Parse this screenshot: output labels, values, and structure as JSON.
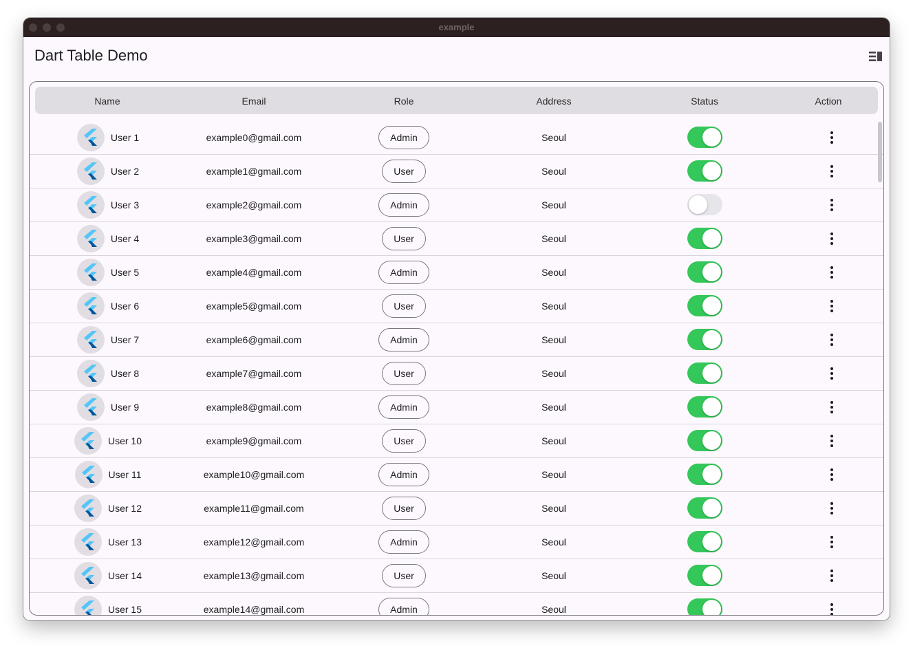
{
  "window": {
    "title": "example"
  },
  "appbar": {
    "title": "Dart Table Demo",
    "action_icon": "view-sidebar-icon"
  },
  "table": {
    "columns": [
      "Name",
      "Email",
      "Role",
      "Address",
      "Status",
      "Action"
    ],
    "rows": [
      {
        "name": "User 1",
        "email": "example0@gmail.com",
        "role": "Admin",
        "address": "Seoul",
        "status": true
      },
      {
        "name": "User 2",
        "email": "example1@gmail.com",
        "role": "User",
        "address": "Seoul",
        "status": true
      },
      {
        "name": "User 3",
        "email": "example2@gmail.com",
        "role": "Admin",
        "address": "Seoul",
        "status": false
      },
      {
        "name": "User 4",
        "email": "example3@gmail.com",
        "role": "User",
        "address": "Seoul",
        "status": true
      },
      {
        "name": "User 5",
        "email": "example4@gmail.com",
        "role": "Admin",
        "address": "Seoul",
        "status": true
      },
      {
        "name": "User 6",
        "email": "example5@gmail.com",
        "role": "User",
        "address": "Seoul",
        "status": true
      },
      {
        "name": "User 7",
        "email": "example6@gmail.com",
        "role": "Admin",
        "address": "Seoul",
        "status": true
      },
      {
        "name": "User 8",
        "email": "example7@gmail.com",
        "role": "User",
        "address": "Seoul",
        "status": true
      },
      {
        "name": "User 9",
        "email": "example8@gmail.com",
        "role": "Admin",
        "address": "Seoul",
        "status": true
      },
      {
        "name": "User 10",
        "email": "example9@gmail.com",
        "role": "User",
        "address": "Seoul",
        "status": true
      },
      {
        "name": "User 11",
        "email": "example10@gmail.com",
        "role": "Admin",
        "address": "Seoul",
        "status": true
      },
      {
        "name": "User 12",
        "email": "example11@gmail.com",
        "role": "User",
        "address": "Seoul",
        "status": true
      },
      {
        "name": "User 13",
        "email": "example12@gmail.com",
        "role": "Admin",
        "address": "Seoul",
        "status": true
      },
      {
        "name": "User 14",
        "email": "example13@gmail.com",
        "role": "User",
        "address": "Seoul",
        "status": true
      },
      {
        "name": "User 15",
        "email": "example14@gmail.com",
        "role": "Admin",
        "address": "Seoul",
        "status": true
      }
    ],
    "avatar_icon": "flutter-logo-icon",
    "action_icon": "more-vert-icon"
  },
  "colors": {
    "toggle_on": "#34c759",
    "toggle_off": "#e6e5ea",
    "header_bg": "#e0dde2",
    "titlebar": "#2d2020"
  }
}
